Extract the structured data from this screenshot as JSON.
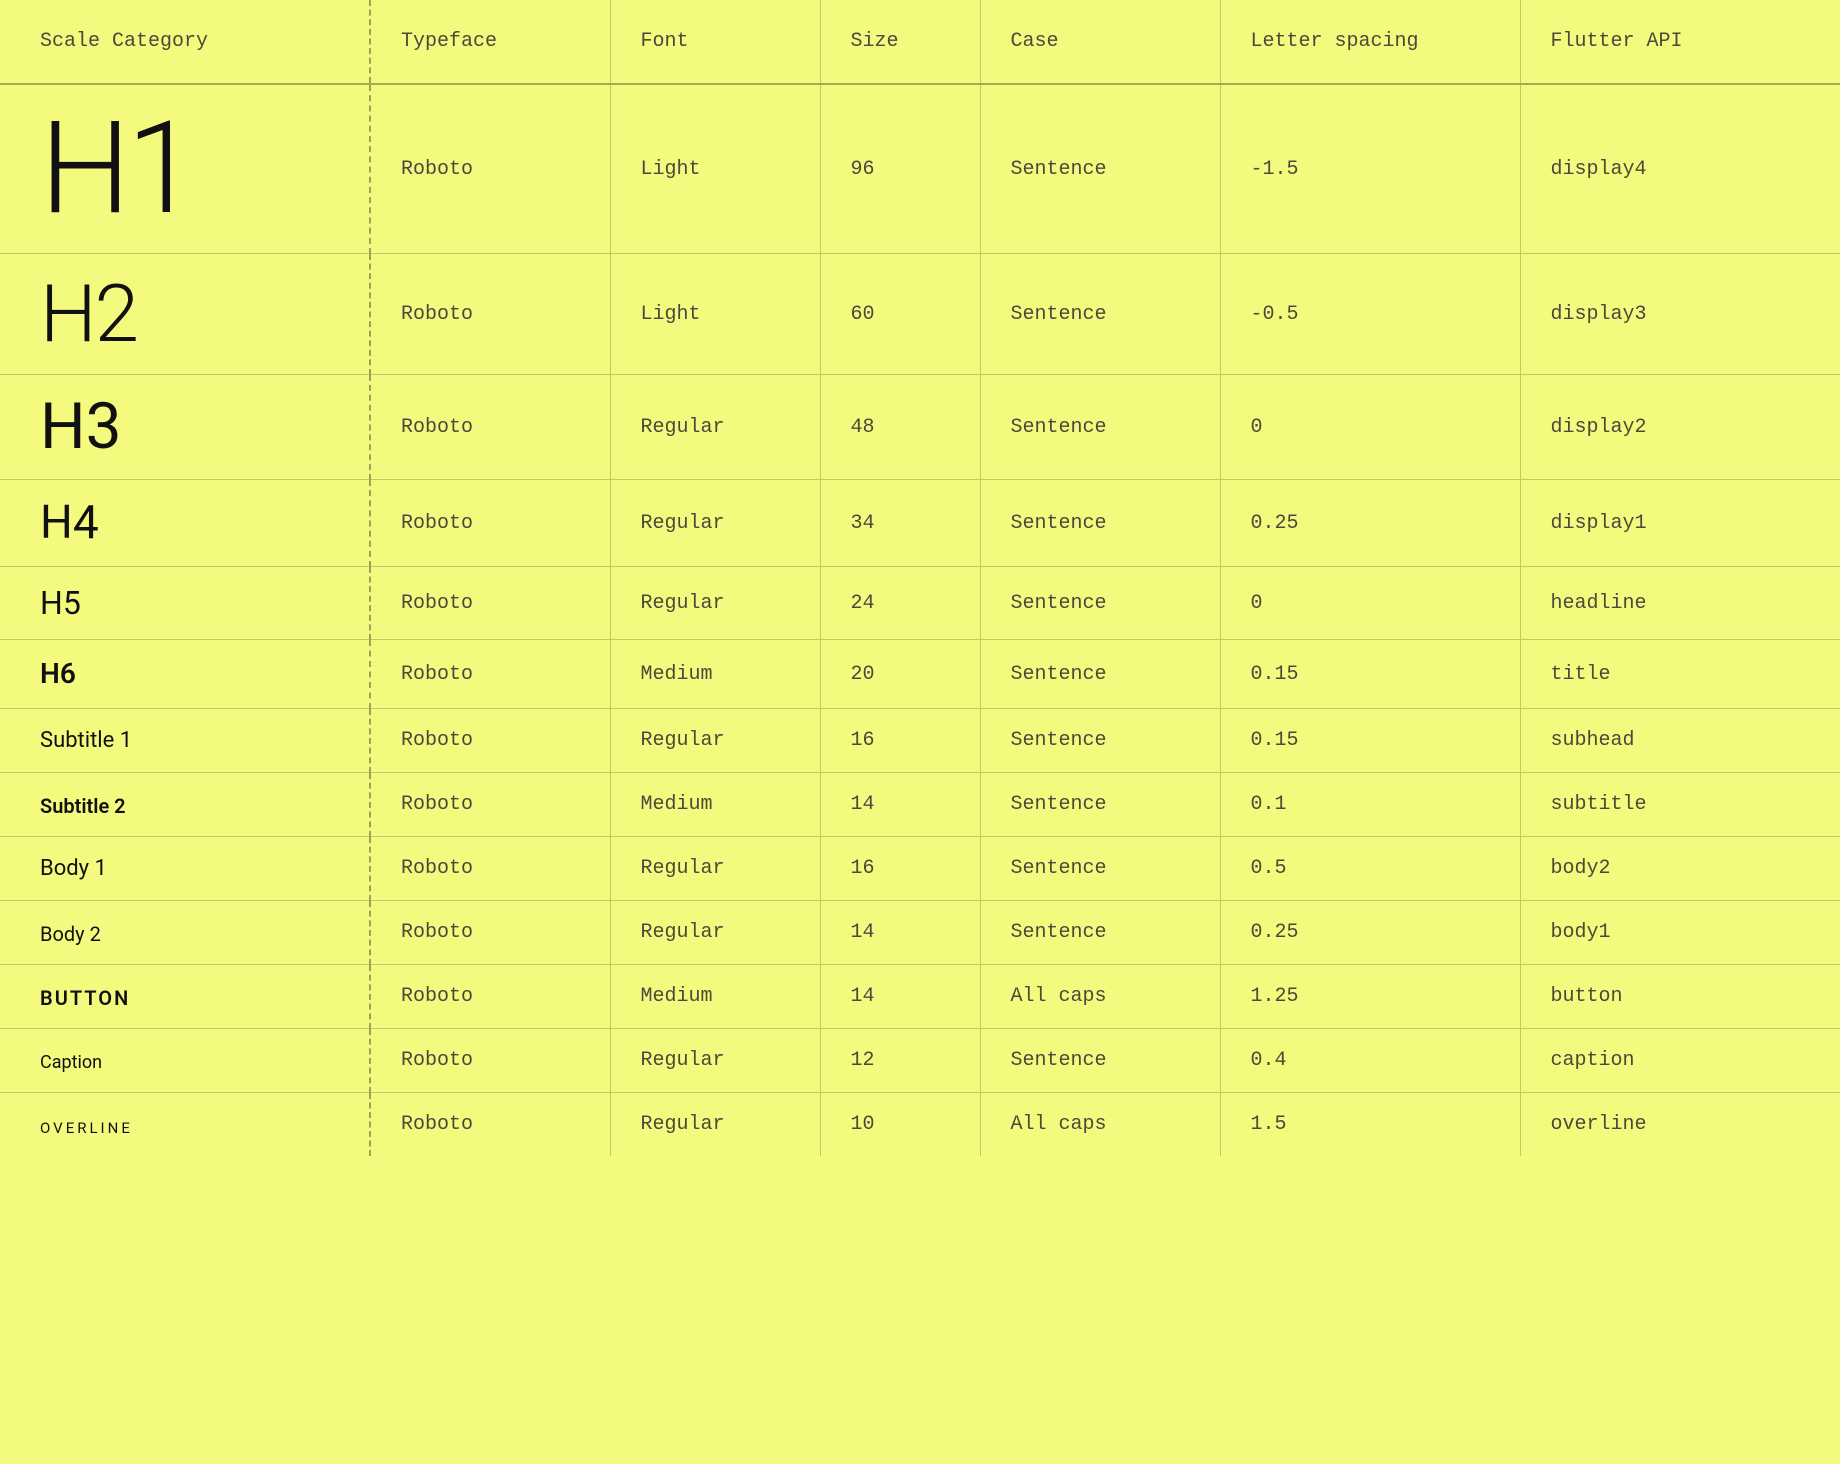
{
  "headers": {
    "scale": "Scale Category",
    "typeface": "Typeface",
    "font": "Font",
    "size": "Size",
    "case": "Case",
    "spacing": "Letter spacing",
    "api": "Flutter API"
  },
  "rows": [
    {
      "scale_label": "H1",
      "specimen_size": 128,
      "weight": "light",
      "caps": false,
      "extra_ls": -4,
      "typeface": "Roboto",
      "font": "Light",
      "size": "96",
      "case": "Sentence",
      "spacing": "-1.5",
      "api": "display4"
    },
    {
      "scale_label": "H2",
      "specimen_size": 80,
      "weight": "light",
      "caps": false,
      "extra_ls": -2,
      "typeface": "Roboto",
      "font": "Light",
      "size": "60",
      "case": "Sentence",
      "spacing": "-0.5",
      "api": "display3"
    },
    {
      "scale_label": "H3",
      "specimen_size": 64,
      "weight": "regular",
      "caps": false,
      "extra_ls": 0,
      "typeface": "Roboto",
      "font": "Regular",
      "size": "48",
      "case": "Sentence",
      "spacing": "0",
      "api": "display2"
    },
    {
      "scale_label": "H4",
      "specimen_size": 46,
      "weight": "regular",
      "caps": false,
      "extra_ls": 0,
      "typeface": "Roboto",
      "font": "Regular",
      "size": "34",
      "case": "Sentence",
      "spacing": "0.25",
      "api": "display1"
    },
    {
      "scale_label": "H5",
      "specimen_size": 32,
      "weight": "regular",
      "caps": false,
      "extra_ls": 0,
      "typeface": "Roboto",
      "font": "Regular",
      "size": "24",
      "case": "Sentence",
      "spacing": "0",
      "api": "headline"
    },
    {
      "scale_label": "H6",
      "specimen_size": 28,
      "weight": "medium",
      "caps": false,
      "extra_ls": 0,
      "typeface": "Roboto",
      "font": "Medium",
      "size": "20",
      "case": "Sentence",
      "spacing": "0.15",
      "api": "title"
    },
    {
      "scale_label": "Subtitle 1",
      "specimen_size": 22,
      "weight": "regular",
      "caps": false,
      "extra_ls": 0,
      "typeface": "Roboto",
      "font": "Regular",
      "size": "16",
      "case": "Sentence",
      "spacing": "0.15",
      "api": "subhead"
    },
    {
      "scale_label": "Subtitle 2",
      "specimen_size": 20,
      "weight": "medium",
      "caps": false,
      "extra_ls": 0,
      "typeface": "Roboto",
      "font": "Medium",
      "size": "14",
      "case": "Sentence",
      "spacing": "0.1",
      "api": "subtitle"
    },
    {
      "scale_label": "Body 1",
      "specimen_size": 22,
      "weight": "regular",
      "caps": false,
      "extra_ls": 0,
      "typeface": "Roboto",
      "font": "Regular",
      "size": "16",
      "case": "Sentence",
      "spacing": "0.5",
      "api": "body2"
    },
    {
      "scale_label": "Body 2",
      "specimen_size": 20,
      "weight": "regular",
      "caps": false,
      "extra_ls": 0,
      "typeface": "Roboto",
      "font": "Regular",
      "size": "14",
      "case": "Sentence",
      "spacing": "0.25",
      "api": "body1"
    },
    {
      "scale_label": "BUTTON",
      "specimen_size": 20,
      "weight": "medium",
      "caps": true,
      "extra_ls": 2,
      "typeface": "Roboto",
      "font": "Medium",
      "size": "14",
      "case": "All caps",
      "spacing": "1.25",
      "api": "button"
    },
    {
      "scale_label": "Caption",
      "specimen_size": 18,
      "weight": "regular",
      "caps": false,
      "extra_ls": 0,
      "typeface": "Roboto",
      "font": "Regular",
      "size": "12",
      "case": "Sentence",
      "spacing": "0.4",
      "api": "caption"
    },
    {
      "scale_label": "OVERLINE",
      "specimen_size": 15,
      "weight": "regular",
      "caps": true,
      "extra_ls": 3,
      "typeface": "Roboto",
      "font": "Regular",
      "size": "10",
      "case": "All caps",
      "spacing": "1.5",
      "api": "overline"
    }
  ]
}
